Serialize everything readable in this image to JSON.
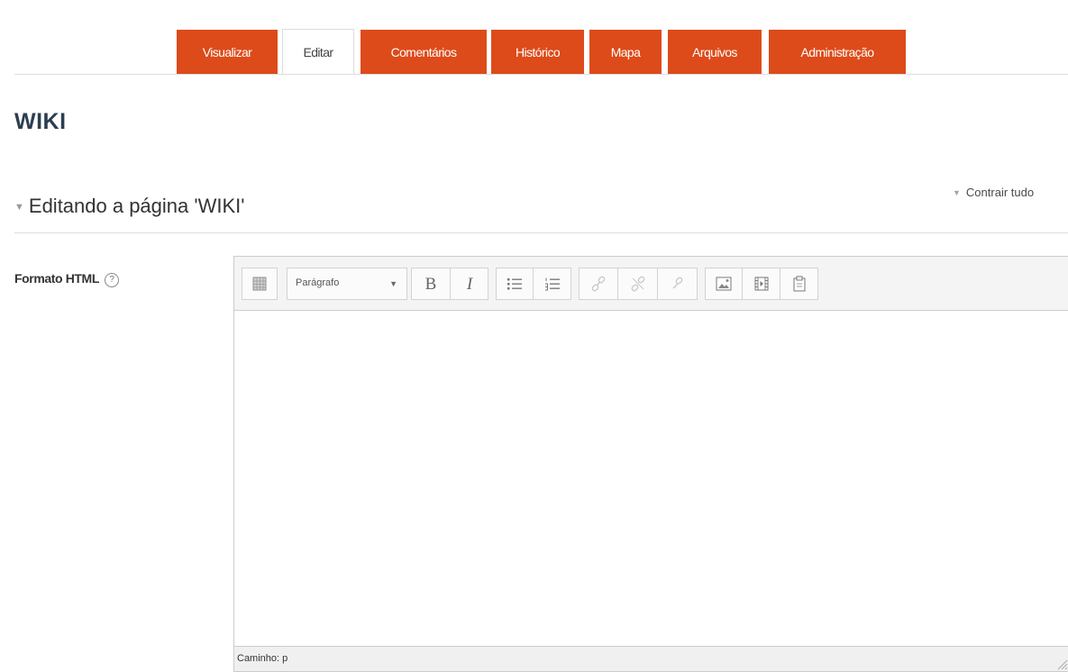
{
  "tabs": [
    {
      "label": "Visualizar",
      "active": false
    },
    {
      "label": "Editar",
      "active": true
    },
    {
      "label": "Comentários",
      "active": false
    },
    {
      "label": "Histórico",
      "active": false
    },
    {
      "label": "Mapa",
      "active": false
    },
    {
      "label": "Arquivos",
      "active": false
    },
    {
      "label": "Administração",
      "active": false
    }
  ],
  "page": {
    "title": "WIKI"
  },
  "collapse_all_label": "Contrair tudo",
  "section": {
    "title": "Editando a página 'WIKI'"
  },
  "field": {
    "label": "Formato HTML",
    "help_icon": "question-circle-icon"
  },
  "editor": {
    "format_select": "Parágrafo",
    "toolbar_icons": [
      "toggle-toolbar-icon",
      "bold-icon",
      "italic-icon",
      "unordered-list-icon",
      "ordered-list-icon",
      "link-icon",
      "unlink-icon",
      "anchor-icon",
      "image-icon",
      "media-icon",
      "paste-icon"
    ],
    "status_path": "Caminho: p"
  },
  "colors": {
    "tab_accent": "#dd4b1a",
    "title": "#2c3e50"
  }
}
